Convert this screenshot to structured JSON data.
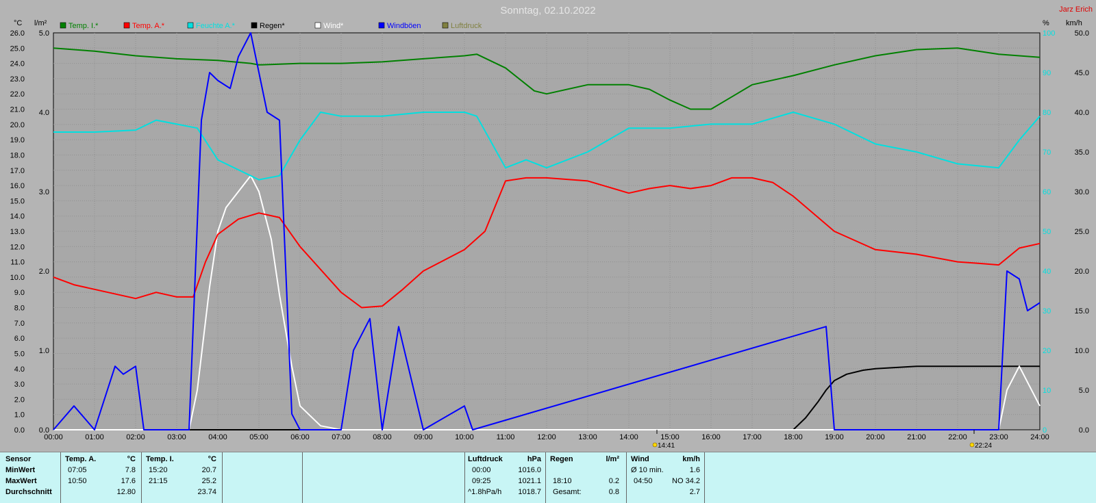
{
  "header": {
    "title": "Sonntag, 02.10.2022",
    "author": "Jarz Erich"
  },
  "axes": {
    "left_unit_temp": "°C",
    "left_unit_rain": "l/m²",
    "right_unit_pct": "%",
    "right_unit_wind": "km/h",
    "temp_ticks": [
      "26.0",
      "25.0",
      "24.0",
      "23.0",
      "22.0",
      "21.0",
      "20.0",
      "19.0",
      "18.0",
      "17.0",
      "16.0",
      "15.0",
      "14.0",
      "13.0",
      "12.0",
      "11.0",
      "10.0",
      "9.0",
      "8.0",
      "7.0",
      "6.0",
      "5.0",
      "4.0",
      "3.0",
      "2.0",
      "1.0",
      "0.0"
    ],
    "rain_ticks": [
      "5.0",
      "4.0",
      "3.0",
      "2.0",
      "1.0",
      "0.0"
    ],
    "pct_ticks": [
      "100",
      "90",
      "80",
      "70",
      "60",
      "50",
      "40",
      "30",
      "20",
      "10",
      "0"
    ],
    "wind_ticks": [
      "50.0",
      "45.0",
      "40.0",
      "35.0",
      "30.0",
      "25.0",
      "20.0",
      "15.0",
      "10.0",
      "5.0",
      "0.0"
    ],
    "time_ticks": [
      "00:00",
      "01:00",
      "02:00",
      "03:00",
      "04:00",
      "05:00",
      "06:00",
      "07:00",
      "08:00",
      "09:00",
      "10:00",
      "11:00",
      "12:00",
      "13:00",
      "14:00",
      "15:00",
      "16:00",
      "17:00",
      "18:00",
      "19:00",
      "20:00",
      "21:00",
      "22:00",
      "23:00",
      "24:00"
    ]
  },
  "legend": [
    {
      "label": "Temp. I.*",
      "color": "#008000"
    },
    {
      "label": "Temp. A.*",
      "color": "#ff0000"
    },
    {
      "label": "Feuchte A.*",
      "color": "#00e0e0"
    },
    {
      "label": "Regen*",
      "color": "#000000"
    },
    {
      "label": "Wind*",
      "color": "#ffffff"
    },
    {
      "label": "Windböen",
      "color": "#0000ff"
    },
    {
      "label": "Luftdruck",
      "color": "#808040"
    }
  ],
  "markers": {
    "sunrise": "14:41",
    "sunset": "22:24"
  },
  "chart_data": {
    "type": "line",
    "title": "Sonntag, 02.10.2022",
    "xlabel": "",
    "ylabel": "°C",
    "xlim": [
      0,
      24
    ],
    "ylim_temp": [
      0,
      26
    ],
    "ylim_rain": [
      0,
      5
    ],
    "ylim_pct": [
      0,
      100
    ],
    "ylim_wind": [
      0,
      50
    ],
    "grid": true,
    "legend": "top",
    "series": [
      {
        "name": "Temp. I.*",
        "axis": "temp",
        "color": "#008000",
        "x": [
          0,
          1,
          2,
          3,
          4,
          4.8,
          5,
          6,
          7,
          8,
          9,
          10,
          10.3,
          11,
          11.7,
          12,
          13,
          14,
          14.5,
          15,
          15.5,
          16,
          16.5,
          17,
          18,
          19,
          20,
          21,
          22,
          23,
          23.5,
          24
        ],
        "y": [
          25.0,
          24.8,
          24.5,
          24.3,
          24.2,
          24.0,
          23.9,
          24.0,
          24.0,
          24.1,
          24.3,
          24.5,
          24.6,
          23.7,
          22.2,
          22.0,
          22.6,
          22.6,
          22.3,
          21.6,
          21.0,
          21.0,
          21.8,
          22.6,
          23.2,
          23.9,
          24.5,
          24.9,
          25.0,
          24.6,
          24.5,
          24.4
        ]
      },
      {
        "name": "Temp. A.*",
        "axis": "temp",
        "color": "#ff0000",
        "x": [
          0,
          0.5,
          1,
          2,
          2.5,
          3,
          3.4,
          3.7,
          4,
          4.5,
          5,
          5.5,
          6,
          7,
          7.5,
          8,
          8.5,
          9,
          10,
          10.5,
          11,
          11.5,
          12,
          13,
          14,
          14.5,
          15,
          15.5,
          16,
          16.5,
          17,
          17.5,
          18,
          19,
          20,
          21,
          22,
          22.5,
          23,
          23.5,
          24
        ],
        "y": [
          10.0,
          9.5,
          9.2,
          8.6,
          9.0,
          8.7,
          8.7,
          11.0,
          12.8,
          13.8,
          14.2,
          13.9,
          12.0,
          9.0,
          8.0,
          8.1,
          9.2,
          10.4,
          11.8,
          13.0,
          16.3,
          16.5,
          16.5,
          16.3,
          15.5,
          15.8,
          16.0,
          15.8,
          16.0,
          16.5,
          16.5,
          16.2,
          15.3,
          13.0,
          11.8,
          11.5,
          11.0,
          10.9,
          10.8,
          11.9,
          12.2
        ]
      },
      {
        "name": "Feuchte A.*",
        "axis": "pct",
        "color": "#00e0e0",
        "x": [
          0,
          1,
          2,
          2.5,
          3,
          3.5,
          4,
          5,
          5.5,
          6,
          6.5,
          7,
          8,
          9,
          10,
          10.3,
          11,
          11.5,
          12,
          13,
          14,
          15,
          16,
          17,
          18,
          19,
          20,
          21,
          22,
          23,
          23.5,
          24
        ],
        "y": [
          75,
          75,
          75.5,
          78,
          77,
          76,
          68,
          63,
          64,
          73,
          80,
          79,
          79,
          80,
          80,
          79,
          66,
          68,
          66,
          70,
          76,
          76,
          77,
          77,
          80,
          77,
          72,
          70,
          67,
          66,
          73,
          79
        ]
      },
      {
        "name": "Regen*",
        "axis": "rain",
        "color": "#000000",
        "x": [
          0,
          18.0,
          18.3,
          18.6,
          18.8,
          19.0,
          19.3,
          19.7,
          20,
          21,
          22,
          23,
          24
        ],
        "y": [
          0,
          0,
          0.15,
          0.35,
          0.5,
          0.62,
          0.7,
          0.75,
          0.77,
          0.8,
          0.8,
          0.8,
          0.8
        ]
      },
      {
        "name": "Wind*",
        "axis": "wind",
        "color": "#ffffff",
        "x": [
          0,
          3.3,
          3.5,
          3.8,
          4,
          4.2,
          4.5,
          4.8,
          5,
          5.3,
          5.5,
          5.8,
          6,
          6.5,
          7,
          7.5,
          8,
          9,
          23,
          23.2,
          23.5,
          23.7,
          24
        ],
        "y": [
          0,
          0,
          5,
          18,
          25,
          28,
          30,
          32,
          30,
          24,
          17,
          8,
          3,
          0.5,
          0,
          0,
          0,
          0,
          0,
          5,
          8,
          6,
          3
        ]
      },
      {
        "name": "Windböen",
        "axis": "wind",
        "color": "#0000ff",
        "x": [
          0,
          0.5,
          1,
          1.5,
          1.7,
          2,
          2.2,
          3.3,
          3.6,
          3.8,
          4,
          4.3,
          4.5,
          4.8,
          5,
          5.2,
          5.5,
          5.8,
          6,
          7,
          7.3,
          7.7,
          8,
          8.4,
          9,
          10,
          10.2,
          18.8,
          19.0,
          19.2,
          23,
          23.2,
          23.5,
          23.7,
          24
        ],
        "y": [
          0,
          3,
          0,
          8,
          7,
          8,
          0,
          0,
          39,
          45,
          44,
          43,
          47,
          50,
          45,
          40,
          39,
          2,
          0,
          0,
          10,
          14,
          0,
          13,
          0,
          3,
          0,
          13,
          0,
          0,
          0,
          20,
          19,
          15,
          16
        ]
      }
    ]
  },
  "summary": {
    "sensor": {
      "label": "Sensor",
      "rows": [
        "MinWert",
        "MaxWert",
        "Durchschnitt"
      ]
    },
    "temp_a": {
      "label": "Temp. A.",
      "unit": "°C",
      "min_time": "07:05",
      "min_val": "7.8",
      "max_time": "10:50",
      "max_val": "17.6",
      "avg": "12.80"
    },
    "temp_i": {
      "label": "Temp. I.",
      "unit": "°C",
      "min_time": "15:20",
      "min_val": "20.7",
      "max_time": "21:15",
      "max_val": "25.2",
      "avg": "23.74"
    },
    "pressure": {
      "label": "Luftdruck",
      "unit": "hPa",
      "r1_time": "00:00",
      "r1_val": "1016.0",
      "r2_time": "09:25",
      "r2_val": "1021.1",
      "r3_time": "^1.8hPa/h",
      "r3_val": "1018.7"
    },
    "rain": {
      "label": "Regen",
      "unit": "l/m²",
      "r2_time": "18:10",
      "r2_val": "0.2",
      "r3_time": "Gesamt:",
      "r3_val": "0.8"
    },
    "wind": {
      "label": "Wind",
      "unit": "km/h",
      "r1_time": "Ø 10 min.",
      "r1_val": "1.6",
      "r2_time": "04:50",
      "r2_val": "NO 34.2",
      "r3_val": "2.7"
    }
  }
}
